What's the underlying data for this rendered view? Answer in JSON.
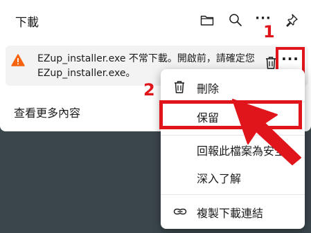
{
  "panel": {
    "title": "下載",
    "see_more": "查看更多內容"
  },
  "toolbar_icons": [
    "folder-icon",
    "search-icon",
    "more-icon",
    "pin-icon"
  ],
  "toolbar_more": "···",
  "download_item": {
    "line1": "EZup_installer.exe 不常下載。開啟前，請確定您",
    "line2": "EZup_installer.exe。"
  },
  "menu": {
    "items": [
      {
        "label": "刪除",
        "icon": "trash-icon"
      },
      {
        "label": "保留",
        "icon": ""
      },
      {
        "label": "回報此檔案為安全",
        "icon": ""
      },
      {
        "label": "深入了解",
        "icon": ""
      },
      {
        "label": "複製下載連結",
        "icon": "link-icon"
      }
    ]
  },
  "annotations": {
    "step1": "1",
    "step2": "2"
  },
  "colors": {
    "accent_red": "#e0151b",
    "warning": "#f7630c",
    "background": "#3b464b"
  }
}
